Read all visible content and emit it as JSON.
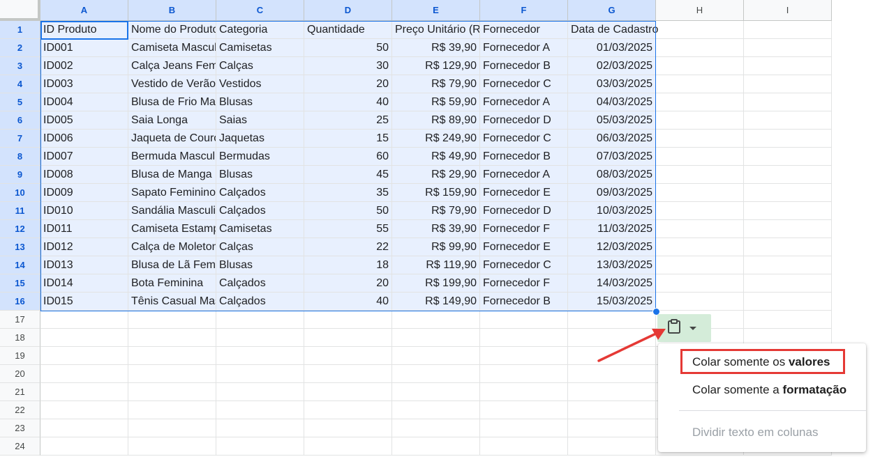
{
  "columns": [
    "A",
    "B",
    "C",
    "D",
    "E",
    "F",
    "G",
    "H",
    "I"
  ],
  "row_count": 24,
  "rows": [
    [
      "ID Produto",
      "Nome do Produto",
      "Categoria",
      "Quantidade",
      "Preço Unitário (R$)",
      "Fornecedor",
      "Data de Cadastro"
    ],
    [
      "ID001",
      " Camiseta  Masculina",
      "Camisetas",
      "50",
      "R$ 39,90",
      "Fornecedor A",
      "01/03/2025"
    ],
    [
      "ID002",
      "Calça Jeans  Feminina",
      "Calças",
      "30",
      "R$ 129,90",
      "Fornecedor B",
      "02/03/2025"
    ],
    [
      "ID003",
      "Vestido de Verão",
      "Vestidos",
      "20",
      "R$ 79,90",
      "Fornecedor C",
      "03/03/2025"
    ],
    [
      "ID004",
      "Blusa de Frio   Masculina",
      "Blusas",
      "40",
      "R$ 59,90",
      "Fornecedor A",
      "04/03/2025"
    ],
    [
      "ID005",
      "Saia  Longa",
      "Saias",
      "25",
      "R$ 89,90",
      "Fornecedor D",
      "05/03/2025"
    ],
    [
      "ID006",
      "Jaqueta de Couro",
      "Jaquetas",
      "15",
      "R$ 249,90",
      "Fornecedor C",
      "06/03/2025"
    ],
    [
      "ID007",
      "Bermuda Masculina",
      "Bermudas",
      "60",
      "R$ 49,90",
      "Fornecedor B",
      "07/03/2025"
    ],
    [
      "ID008",
      "Blusa de Manga",
      "Blusas",
      "45",
      "R$ 29,90",
      "Fornecedor A",
      "08/03/2025"
    ],
    [
      "ID009",
      "Sapato   Feminino",
      "Calçados",
      "35",
      "R$ 159,90",
      "Fornecedor E",
      "09/03/2025"
    ],
    [
      "ID010",
      "Sandália Masculina",
      "Calçados",
      "50",
      "R$ 79,90",
      "Fornecedor D",
      "10/03/2025"
    ],
    [
      "ID011",
      "Camiseta   Estampada",
      "Camisetas",
      "55",
      "R$ 39,90",
      "Fornecedor F",
      "11/03/2025"
    ],
    [
      "ID012",
      "Calça de Moletom",
      "Calças",
      "22",
      "R$ 99,90",
      "Fornecedor E",
      "12/03/2025"
    ],
    [
      "ID013",
      "Blusa de Lã Feminina",
      "Blusas",
      "18",
      "R$ 119,90",
      "Fornecedor C",
      "13/03/2025"
    ],
    [
      "ID014",
      "Bota Feminina",
      "Calçados",
      "20",
      "R$ 199,90",
      "Fornecedor F",
      "14/03/2025"
    ],
    [
      "ID015",
      "Tênis Casual Masculino",
      "Calçados",
      "40",
      "R$ 149,90",
      "Fornecedor B",
      "15/03/2025"
    ]
  ],
  "paste_chip": {
    "icon": "clipboard-icon",
    "dropdown_icon": "chevron-down-icon"
  },
  "menu": {
    "item1_prefix": "Colar somente os ",
    "item1_bold": "valores",
    "item2_prefix": "Colar somente a ",
    "item2_bold": "formatação",
    "item3": "Dividir texto em colunas"
  },
  "colors": {
    "selection_fill": "#e8f0fe",
    "selection_border": "#1a73e8",
    "header_selected": "#d3e3fd",
    "paste_chip_bg": "#d4ecd9",
    "annotation_red": "#e53935"
  }
}
